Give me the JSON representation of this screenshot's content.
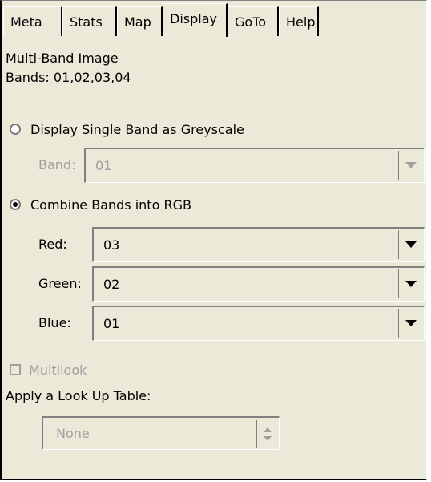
{
  "tabs": [
    "Meta",
    "Stats",
    "Map",
    "Display",
    "GoTo",
    "Help"
  ],
  "active_tab": "Display",
  "info": {
    "image_type": "Multi-Band Image",
    "bands": "Bands: 01,02,03,04"
  },
  "greyscale": {
    "label": "Display Single Band as Greyscale",
    "selected": false,
    "band_label": "Band:",
    "band_value": "01"
  },
  "rgb": {
    "label": "Combine Bands into RGB",
    "selected": true,
    "red_label": "Red:",
    "red_value": "03",
    "green_label": "Green:",
    "green_value": "02",
    "blue_label": "Blue:",
    "blue_value": "01"
  },
  "multilook": {
    "label": "Multilook",
    "checked": false
  },
  "lut": {
    "label": "Apply a Look Up Table:",
    "value": "None"
  },
  "colors": {
    "panel": "#ece9d8",
    "disabled_text": "#a0a0a0"
  },
  "icons": {
    "dropdown": "chevron-down-icon",
    "spinner": "spinner-arrows-icon"
  }
}
